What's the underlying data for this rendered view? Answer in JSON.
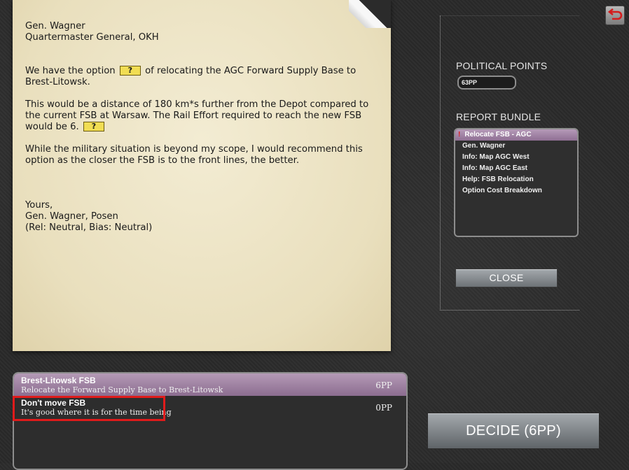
{
  "letter": {
    "to_name": "Gen. Wagner",
    "to_title": "Quartermaster General, OKH",
    "p1_a": "We have the option",
    "p1_b": "of relocating the AGC Forward Supply Base to Brest-Litowsk.",
    "hint_label": "?",
    "p2_a": "This would be a distance of 180 km*s further from the Depot compared to the current FSB at Warsaw. The Rail Effort required to reach the new FSB would be 6.",
    "p3": "While the military situation is beyond my scope, I would recommend this option as the closer the FSB is to the front lines, the better.",
    "signoff": "Yours,",
    "signature": "Gen. Wagner, Posen",
    "relation": "(Rel: Neutral, Bias: Neutral)"
  },
  "political_points": {
    "label": "POLITICAL POINTS",
    "value": "63PP"
  },
  "report_bundle": {
    "label": "REPORT BUNDLE",
    "items": [
      {
        "label": "Relocate FSB - AGC",
        "selected": true
      },
      {
        "label": "Gen. Wagner"
      },
      {
        "label": "Info: Map AGC West"
      },
      {
        "label": "Info: Map AGC East"
      },
      {
        "label": "Help: FSB Relocation"
      },
      {
        "label": "Option Cost Breakdown"
      }
    ]
  },
  "close_label": "CLOSE",
  "options": [
    {
      "title": "Brest-Litowsk FSB",
      "desc": "Relocate the Forward Supply Base to Brest-Litowsk",
      "cost": "6PP",
      "selected": true
    },
    {
      "title": "Don't move FSB",
      "desc": "It's good where it is for the time being",
      "cost": "0PP"
    }
  ],
  "decide_label": "DECIDE (6PP)",
  "colors": {
    "highlight": "#e01b1b",
    "selected_purple": "#8c6d90",
    "hint_yellow": "#f1dd53"
  }
}
